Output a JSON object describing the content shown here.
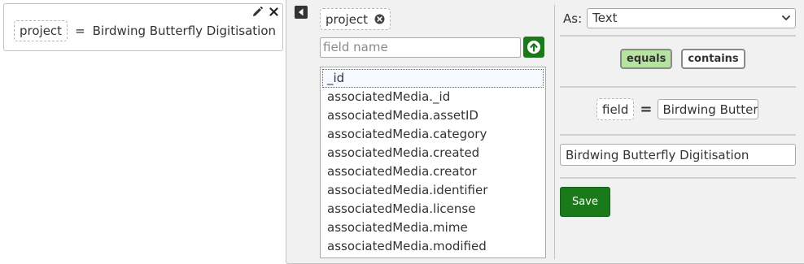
{
  "filter": {
    "field": "project",
    "operator_symbol": "=",
    "value": "Birdwing Butterfly Digitisation",
    "edit_icon": "pencil-icon",
    "close_icon": "close-icon"
  },
  "editor": {
    "collapse_icon": "caret-left-icon",
    "selected_field": "project",
    "field_input": {
      "value": "",
      "placeholder": "field name"
    },
    "go_icon": "arrow-up-circle-icon",
    "field_list": [
      "_id",
      "associatedMedia._id",
      "associatedMedia.assetID",
      "associatedMedia.category",
      "associatedMedia.created",
      "associatedMedia.creator",
      "associatedMedia.identifier",
      "associatedMedia.license",
      "associatedMedia.mime",
      "associatedMedia.modified"
    ],
    "selected_list_index": 0,
    "as_label": "As:",
    "as_value": "Text",
    "operators": [
      {
        "label": "equals",
        "active": true
      },
      {
        "label": "contains",
        "active": false
      }
    ],
    "preview": {
      "field": "field",
      "symbol": "=",
      "value": "Birdwing Butter"
    },
    "value_input": "Birdwing Butterfly Digitisation",
    "save_label": "Save"
  },
  "colors": {
    "accent_green": "#1a7a1a",
    "active_operator": "#b6e3a1",
    "panel_bg": "#f1f1f1"
  }
}
